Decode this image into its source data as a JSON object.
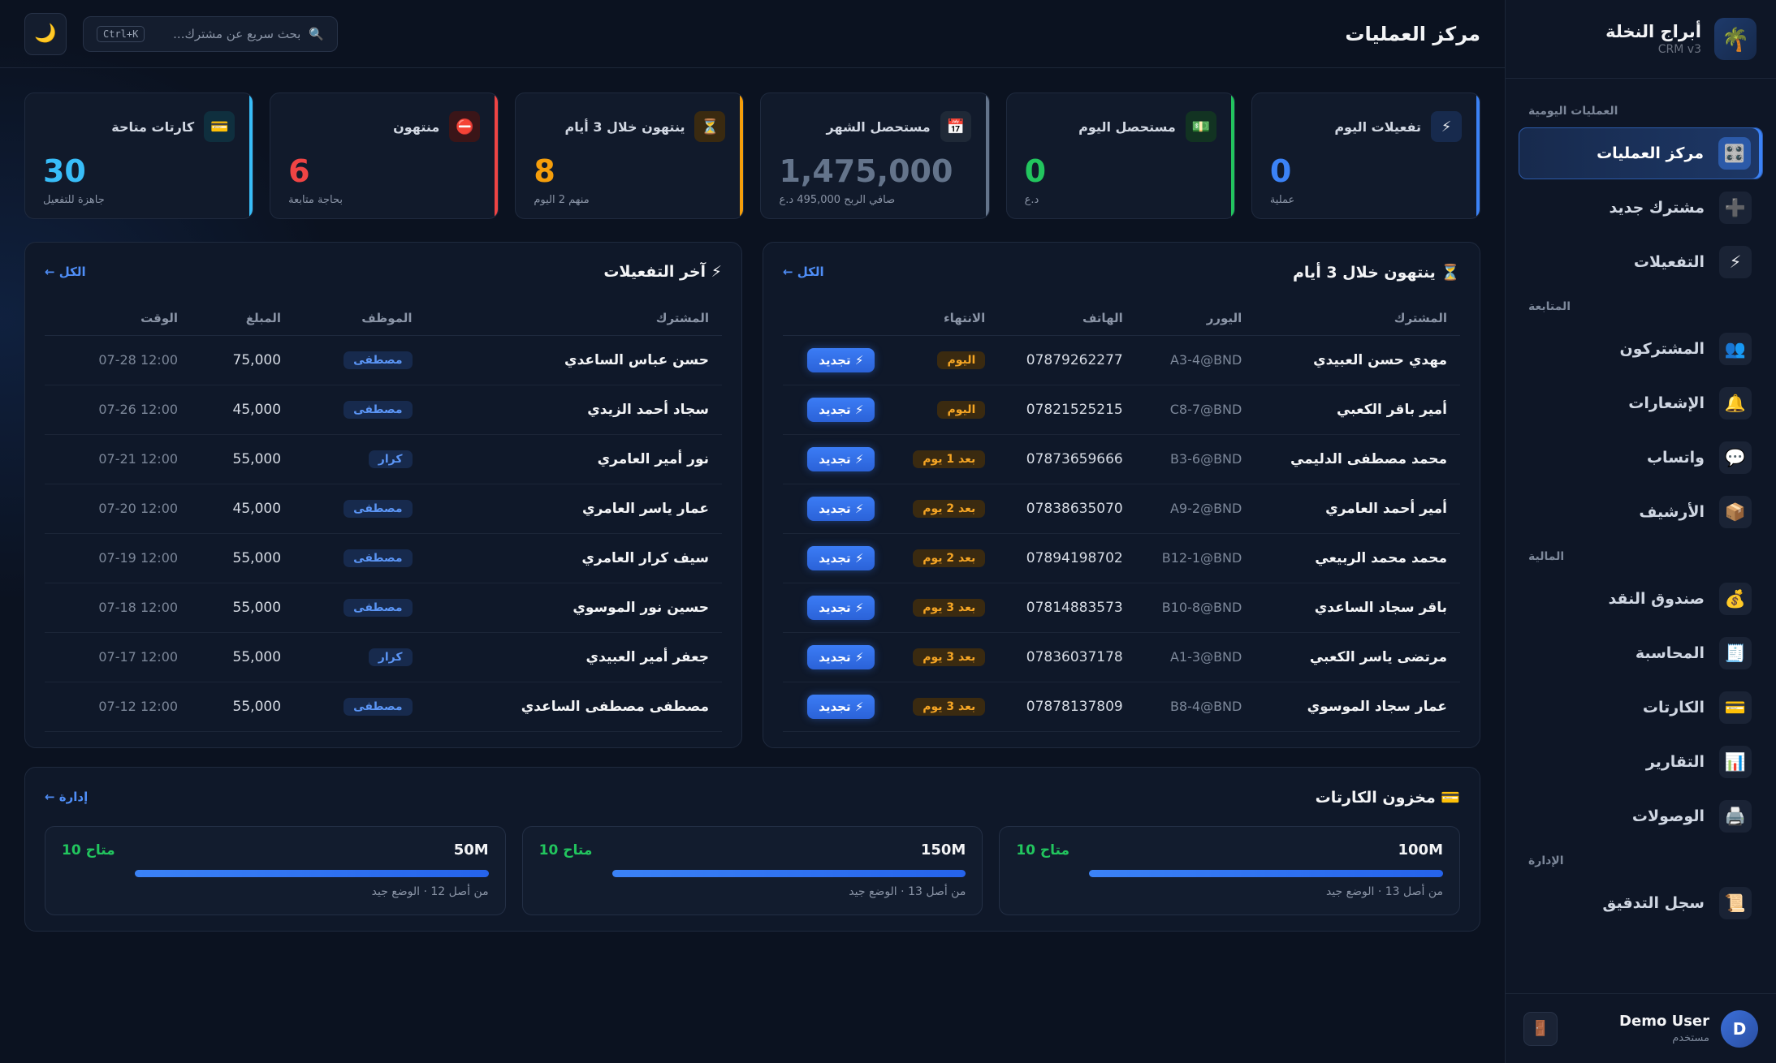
{
  "brand": {
    "name": "أبراج النخلة",
    "version": "CRM v3",
    "logo_icon": "🌴"
  },
  "sidebar": {
    "sections": [
      {
        "title": "العمليات اليومية",
        "items": [
          {
            "label": "مركز العمليات",
            "icon": "🎛️",
            "active": true
          },
          {
            "label": "مشترك جديد",
            "icon": "➕"
          },
          {
            "label": "التفعيلات",
            "icon": "⚡"
          }
        ]
      },
      {
        "title": "المتابعة",
        "items": [
          {
            "label": "المشتركون",
            "icon": "👥"
          },
          {
            "label": "الإشعارات",
            "icon": "🔔"
          },
          {
            "label": "واتساب",
            "icon": "💬"
          },
          {
            "label": "الأرشيف",
            "icon": "📦"
          }
        ]
      },
      {
        "title": "المالية",
        "items": [
          {
            "label": "صندوق النقد",
            "icon": "💰"
          },
          {
            "label": "المحاسبة",
            "icon": "🧾"
          },
          {
            "label": "الكارتات",
            "icon": "💳"
          },
          {
            "label": "التقارير",
            "icon": "📊"
          },
          {
            "label": "الوصولات",
            "icon": "🖨️"
          }
        ]
      },
      {
        "title": "الإدارة",
        "items": [
          {
            "label": "سجل التدقيق",
            "icon": "📜"
          }
        ]
      }
    ]
  },
  "user": {
    "initial": "D",
    "name": "Demo User",
    "role": "مستخدم",
    "logout_icon": "🚪"
  },
  "header": {
    "title": "مركز العمليات",
    "search_placeholder": "بحث سريع عن مشترك...",
    "search_shortcut": "Ctrl+K",
    "search_icon": "🔍",
    "theme_icon": "🌙"
  },
  "stats": [
    {
      "label": "تفعيلات اليوم",
      "value": "0",
      "sub": "عملية",
      "icon": "⚡",
      "accent": "#3b82f6",
      "icon_bg": "#172a4d"
    },
    {
      "label": "مستحصل اليوم",
      "value": "0",
      "sub": "د.ع",
      "icon": "💵",
      "accent": "#22c55e",
      "icon_bg": "#123322"
    },
    {
      "label": "مستحصل الشهر",
      "value": "1,475,000",
      "sub": "صافي الربح 495,000 د.ع",
      "icon": "📅",
      "accent": "#64748b",
      "icon_bg": "#1f2937"
    },
    {
      "label": "ينتهون خلال 3 أيام",
      "value": "8",
      "sub": "منهم 2 اليوم",
      "icon": "⏳",
      "accent": "#f59e0b",
      "icon_bg": "#3a2a10"
    },
    {
      "label": "منتهون",
      "value": "6",
      "sub": "بحاجة متابعة",
      "icon": "⛔",
      "accent": "#ef4444",
      "icon_bg": "#3a1518"
    },
    {
      "label": "كارتات متاحة",
      "value": "30",
      "sub": "جاهزة للتفعيل",
      "icon": "💳",
      "accent": "#38bdf8",
      "icon_bg": "#0f2f3e"
    }
  ],
  "expiring": {
    "title": "⏳ ينتهون خلال 3 أيام",
    "link": "الكل ←",
    "columns": [
      "المشترك",
      "اليورر",
      "الهاتف",
      "الانتهاء",
      ""
    ],
    "renew_label": "⚡ تجديد",
    "rows": [
      {
        "name": "مهدي حسن العبيدي",
        "user": "A3-4@BND",
        "phone": "07879262277",
        "expiry": "اليوم"
      },
      {
        "name": "أمير باقر الكعبي",
        "user": "C8-7@BND",
        "phone": "07821525215",
        "expiry": "اليوم"
      },
      {
        "name": "محمد مصطفى الدليمي",
        "user": "B3-6@BND",
        "phone": "07873659666",
        "expiry": "بعد 1 يوم"
      },
      {
        "name": "أمير أحمد العامري",
        "user": "A9-2@BND",
        "phone": "07838635070",
        "expiry": "بعد 2 يوم"
      },
      {
        "name": "محمد محمد الربيعي",
        "user": "B12-1@BND",
        "phone": "07894198702",
        "expiry": "بعد 2 يوم"
      },
      {
        "name": "باقر سجاد الساعدي",
        "user": "B10-8@BND",
        "phone": "07814883573",
        "expiry": "بعد 3 يوم"
      },
      {
        "name": "مرتضى ياسر الكعبي",
        "user": "A1-3@BND",
        "phone": "07836037178",
        "expiry": "بعد 3 يوم"
      },
      {
        "name": "عمار سجاد الموسوي",
        "user": "B8-4@BND",
        "phone": "07878137809",
        "expiry": "بعد 3 يوم"
      }
    ]
  },
  "activations": {
    "title": "⚡ آخر التفعيلات",
    "link": "الكل ←",
    "columns": [
      "المشترك",
      "الموظف",
      "المبلغ",
      "الوقت"
    ],
    "rows": [
      {
        "name": "حسن عباس الساعدي",
        "employee": "مصطفى",
        "amount": "75,000",
        "time": "07-28 12:00"
      },
      {
        "name": "سجاد أحمد الزيدي",
        "employee": "مصطفى",
        "amount": "45,000",
        "time": "07-26 12:00"
      },
      {
        "name": "نور أمير العامري",
        "employee": "كرار",
        "amount": "55,000",
        "time": "07-21 12:00"
      },
      {
        "name": "عمار ياسر العامري",
        "employee": "مصطفى",
        "amount": "45,000",
        "time": "07-20 12:00"
      },
      {
        "name": "سيف كرار العامري",
        "employee": "مصطفى",
        "amount": "55,000",
        "time": "07-19 12:00"
      },
      {
        "name": "حسين نور الموسوي",
        "employee": "مصطفى",
        "amount": "55,000",
        "time": "07-18 12:00"
      },
      {
        "name": "جعفر أمير العبيدي",
        "employee": "كرار",
        "amount": "55,000",
        "time": "07-17 12:00"
      },
      {
        "name": "مصطفى مصطفى الساعدي",
        "employee": "مصطفى",
        "amount": "55,000",
        "time": "07-12 12:00"
      }
    ]
  },
  "inventory": {
    "title": "💳 مخزون الكارتات",
    "link": "إدارة ←",
    "cards": [
      {
        "name": "100M",
        "available": "متاح 10",
        "sub": "من أصل 13 · الوضع جيد",
        "fill_fraction": 1.0
      },
      {
        "name": "150M",
        "available": "متاح 10",
        "sub": "من أصل 13 · الوضع جيد",
        "fill_fraction": 1.0
      },
      {
        "name": "50M",
        "available": "متاح 10",
        "sub": "من أصل 12 · الوضع جيد",
        "fill_fraction": 1.0
      }
    ]
  }
}
